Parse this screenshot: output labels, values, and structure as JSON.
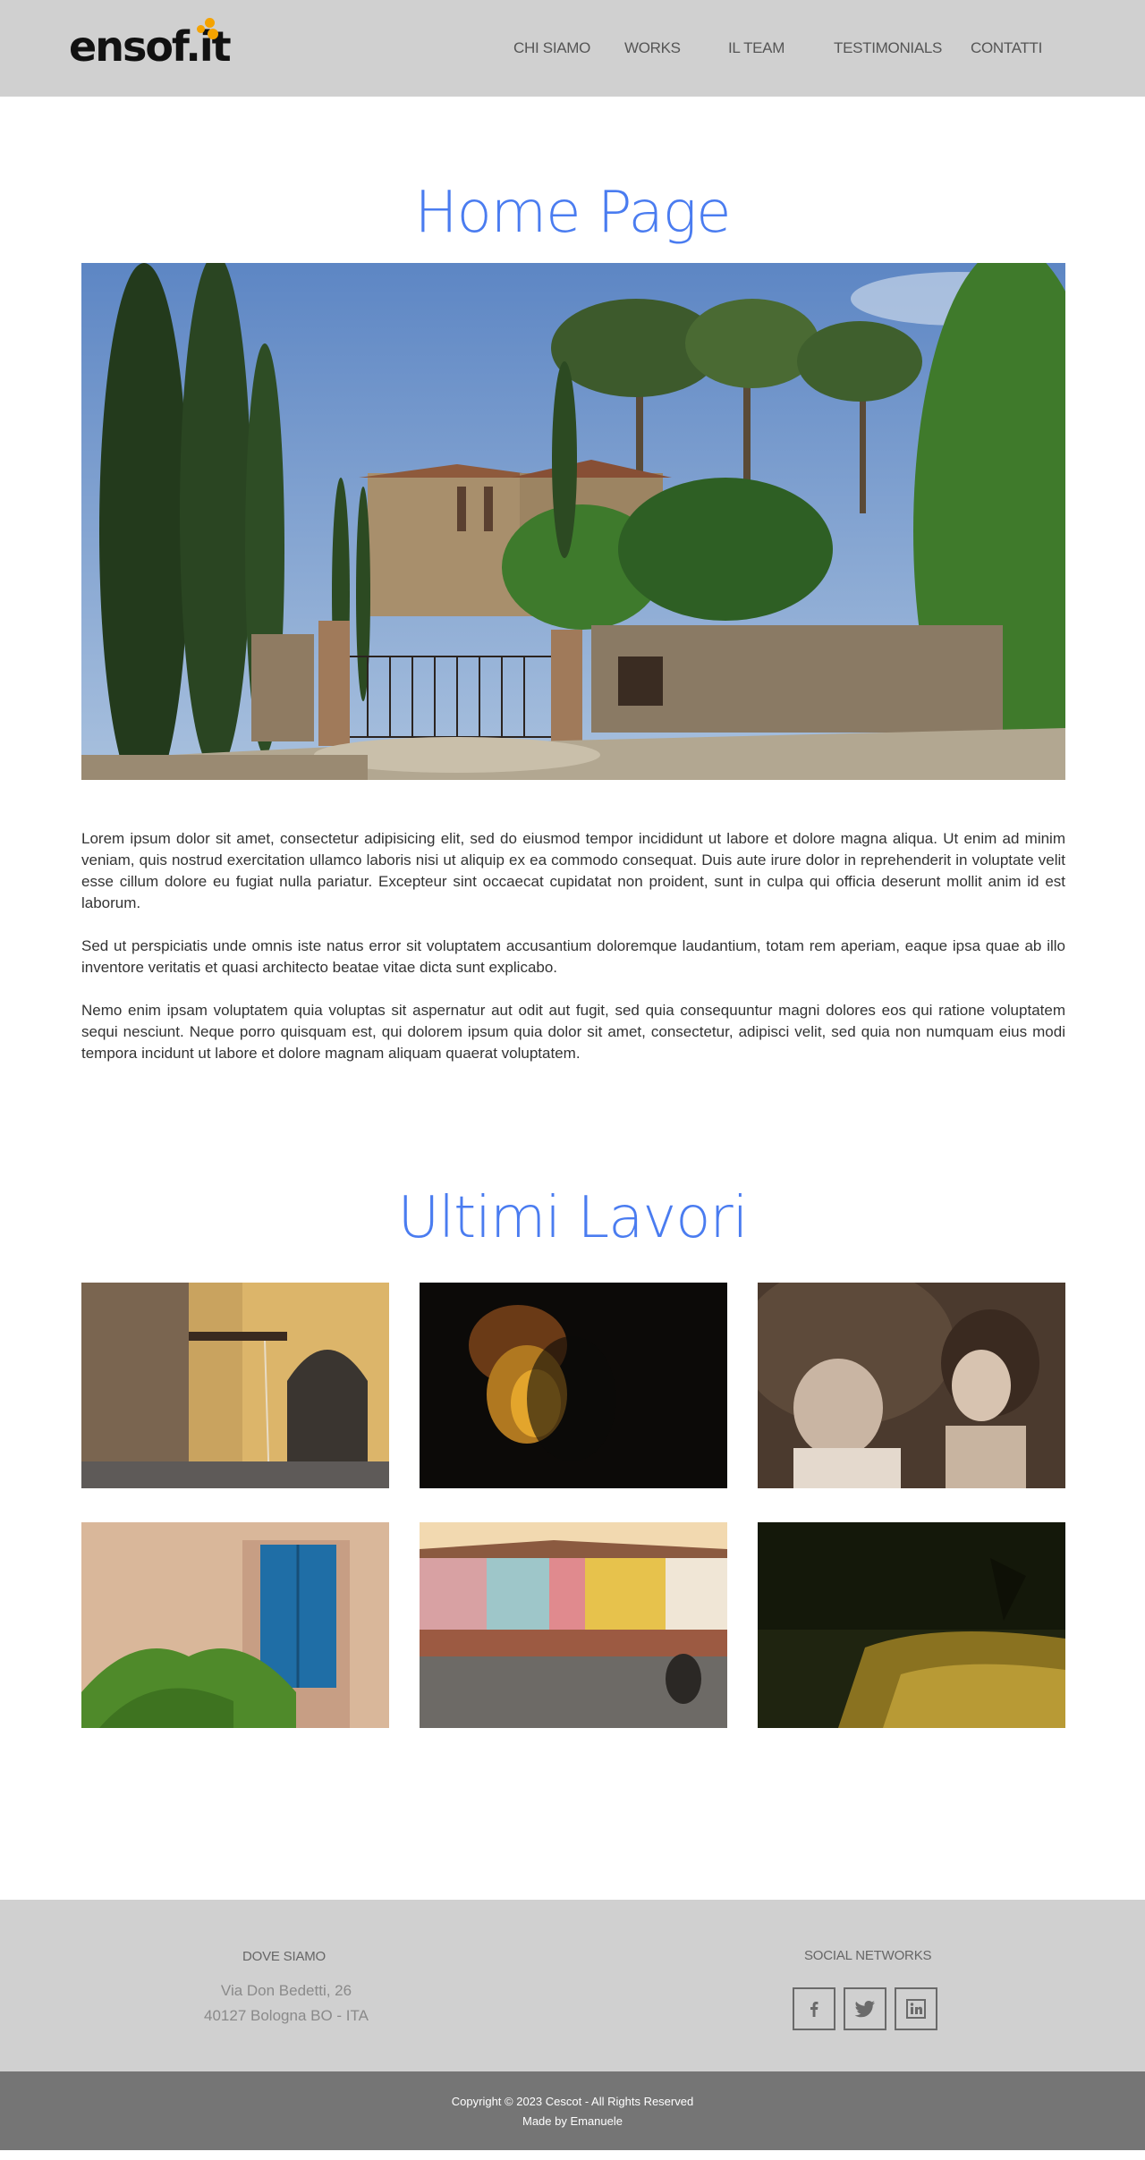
{
  "header": {
    "logo_text": "ensof.it",
    "nav": [
      "CHI SIAMO",
      "WORKS",
      "IL TEAM",
      "TESTIMONIALS",
      "CONTATTI"
    ],
    "background": "#d0d0d0"
  },
  "home": {
    "title": "Home Page",
    "paragraphs": [
      "Lorem ipsum dolor sit amet, consectetur adipisicing elit, sed do eiusmod tempor incididunt ut labore et dolore magna aliqua. Ut enim ad minim veniam, quis nostrud exercitation ullamco laboris nisi ut aliquip ex ea commodo consequat. Duis aute irure dolor in reprehenderit in voluptate velit esse cillum dolore eu fugiat nulla pariatur. Excepteur sint occaecat cupidatat non proident, sunt in culpa qui officia deserunt mollit anim id est laborum.",
      "Sed ut perspiciatis unde omnis iste natus error sit voluptatem accusantium doloremque laudantium, totam rem aperiam, eaque ipsa quae ab illo inventore veritatis et quasi architecto beatae vitae dicta sunt explicabo.",
      "Nemo enim ipsam voluptatem quia voluptas sit aspernatur aut odit aut fugit, sed quia consequuntur magni dolores eos qui ratione voluptatem sequi nesciunt. Neque porro quisquam est, qui dolorem ipsum quia dolor sit amet, consectetur, adipisci velit, sed quia non numquam eius modi tempora incidunt ut labore et dolore magnam aliquam quaerat voluptatem."
    ]
  },
  "works": {
    "title": "Ultimi Lavori"
  },
  "footer": {
    "dove_siamo_title": "DOVE SIAMO",
    "address_line1": "Via Don Bedetti, 26",
    "address_line2": "40127 Bologna BO - ITA",
    "social_title": "SOCIAL NETWORKS",
    "social_icons": [
      "facebook-icon",
      "twitter-icon",
      "linkedin-icon"
    ],
    "copyright": "Copyright © 2023 Cescot - All Rights Reserved",
    "made_by": "Made by Emanuele"
  },
  "colors": {
    "accent": "#4a7cf0",
    "logo_dots": "#f5a300",
    "footer_dark": "#757575"
  }
}
